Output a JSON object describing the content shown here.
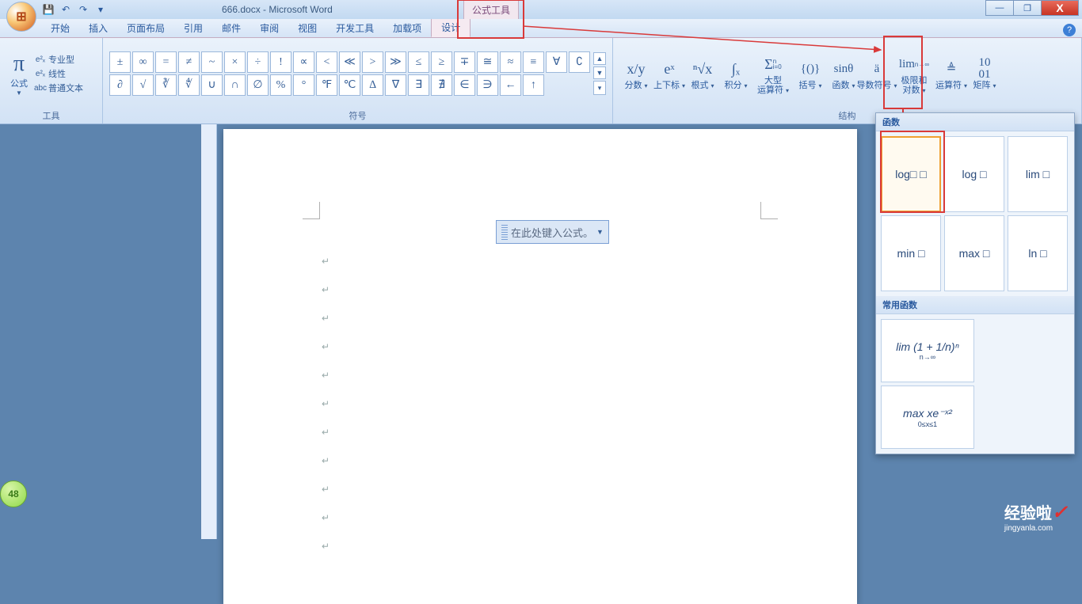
{
  "title": "666.docx - Microsoft Word",
  "context_tab": "公式工具",
  "qat": [
    "💾",
    "↶",
    "↷"
  ],
  "winbtns": {
    "min": "—",
    "max": "❐",
    "close": "X"
  },
  "help": "?",
  "menubar": [
    "开始",
    "插入",
    "页面布局",
    "引用",
    "邮件",
    "审阅",
    "视图",
    "开发工具",
    "加载项",
    "设计"
  ],
  "menubar_active": 9,
  "groups": {
    "tools": {
      "pi": "π",
      "formula": "公式",
      "pro": "专业型",
      "linear": "线性",
      "plain": "普通文本",
      "label": "工具",
      "abc": "abc",
      "e1": "e²ₓ",
      "e2": "e²ₓ"
    },
    "symbols_label": "符号",
    "symbols": [
      [
        "±",
        "∞",
        "=",
        "≠",
        "~",
        "×",
        "÷",
        "!",
        "∝",
        "<",
        "≪",
        ">",
        "≫",
        "≤",
        "≥",
        "∓",
        "≅",
        "≈",
        "≡",
        "∀"
      ],
      [
        "∁",
        "∂",
        "√",
        "∛",
        "∜",
        "∪",
        "∩",
        "∅",
        "%",
        "°",
        "℉",
        "℃",
        "∆",
        "∇",
        "∃",
        "∄",
        "∈",
        "∋",
        "←",
        "↑"
      ]
    ],
    "structs": [
      {
        "icon": "x/y",
        "lbl": "分数"
      },
      {
        "icon": "eˣ",
        "lbl": "上下标"
      },
      {
        "icon": "ⁿ√x",
        "lbl": "根式"
      },
      {
        "icon": "∫ₓ",
        "lbl": "积分"
      },
      {
        "icon": "Σ",
        "lbl": "大型\n运算符",
        "two": true,
        "sub": "n\ni=0"
      },
      {
        "icon": "{()}",
        "lbl": "括号"
      },
      {
        "icon": "sinθ",
        "lbl": "函数"
      },
      {
        "icon": "ä",
        "lbl": "导数符号"
      },
      {
        "icon": "lim",
        "lbl": "极限和\n对数",
        "two": true,
        "sub": "n→∞"
      },
      {
        "icon": "≜",
        "lbl": "运算符"
      },
      {
        "icon": "10\n01",
        "lbl": "矩阵"
      }
    ],
    "structs_label": "结构"
  },
  "equation_placeholder": "在此处键入公式。",
  "gallery": {
    "sec1": "函数",
    "items1": [
      "log□ □",
      "log □",
      "lim □",
      "min □",
      "max □",
      "ln □"
    ],
    "sec2": "常用函数",
    "item2a_top": "lim",
    "item2a_sub": "n→∞",
    "item2a_expr": "(1 + 1/n)ⁿ",
    "item2b_top": "max",
    "item2b_sub": "0≤x≤1",
    "item2b_expr": "xe⁻ˣ²"
  },
  "watermark": {
    "big": "经验啦",
    "check": "✓",
    "dom": "jingyanla.com"
  },
  "badge": "48"
}
